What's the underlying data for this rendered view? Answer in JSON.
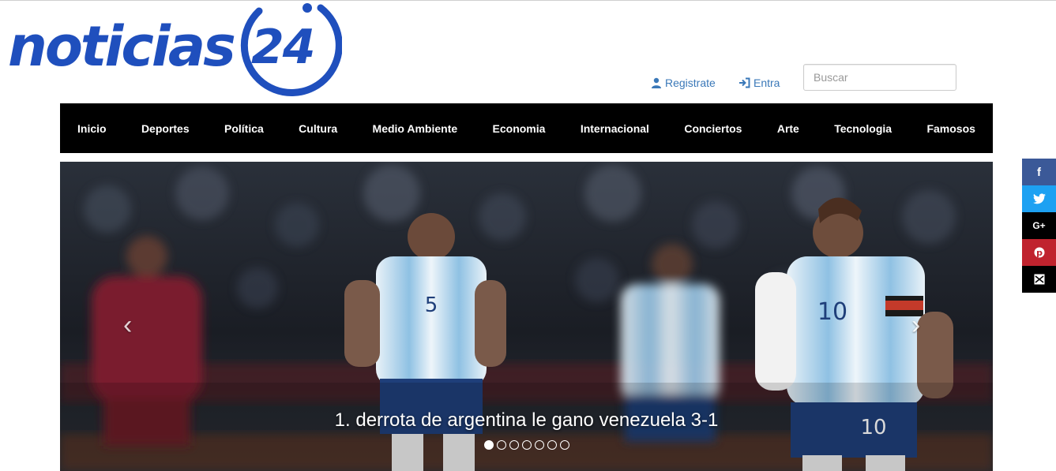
{
  "logo": {
    "word": "noticias",
    "number": "24"
  },
  "header": {
    "register_label": "Registrate",
    "login_label": "Entra",
    "search_placeholder": "Buscar"
  },
  "nav": {
    "items": [
      "Inicio",
      "Deportes",
      "Política",
      "Cultura",
      "Medio Ambiente",
      "Economia",
      "Internacional",
      "Conciertos",
      "Arte",
      "Tecnologia",
      "Famosos"
    ]
  },
  "carousel": {
    "caption": "1. derrota de argentina le gano venezuela 3-1",
    "slide_count": 7,
    "active_slide": 1,
    "prev_icon": "‹",
    "next_icon": "›"
  },
  "share": {
    "items": [
      {
        "icon": "facebook-icon",
        "glyph": "f"
      },
      {
        "icon": "twitter-icon",
        "glyph": "t"
      },
      {
        "icon": "google-plus-icon",
        "glyph": "G+"
      },
      {
        "icon": "pinterest-icon",
        "glyph": "p"
      },
      {
        "icon": "email-icon",
        "glyph": "✉"
      }
    ]
  },
  "colors": {
    "brand": "#1f4fbd",
    "link": "#3a78b8",
    "nav_bg": "#000000",
    "facebook": "#3b5998",
    "twitter": "#1da1f2",
    "pinterest": "#c0232e"
  }
}
